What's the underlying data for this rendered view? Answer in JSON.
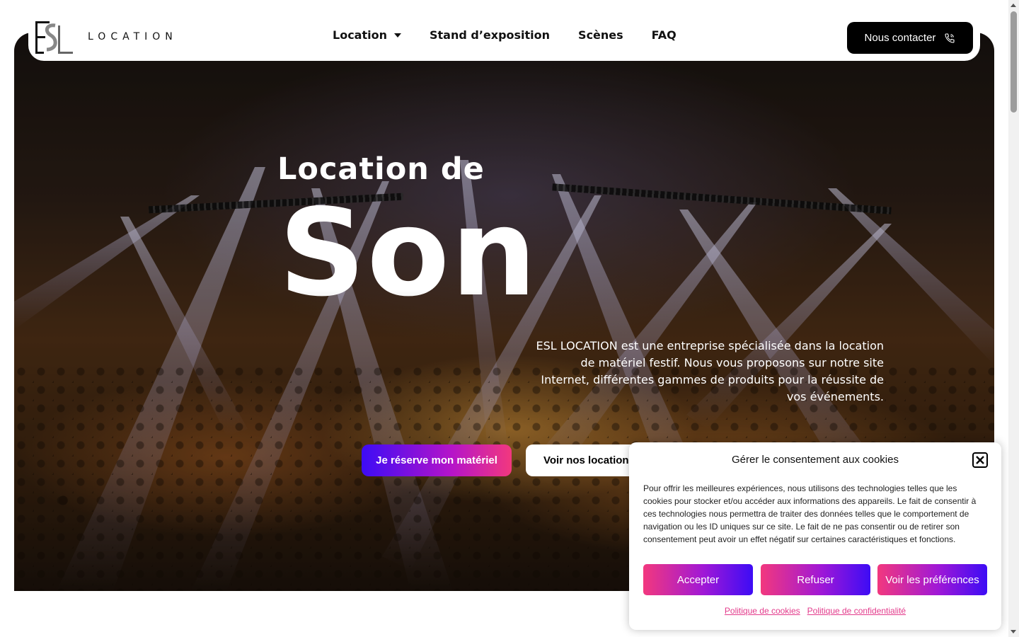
{
  "header": {
    "logo_text": "LOCATION",
    "logo_mark_letters": "ESL",
    "nav": [
      {
        "label": "Location",
        "has_dropdown": true
      },
      {
        "label": "Stand d’exposition"
      },
      {
        "label": "Scènes"
      },
      {
        "label": "FAQ"
      }
    ],
    "contact_label": "Nous contacter",
    "contact_icon": "phone-call-icon"
  },
  "hero": {
    "title_small": "Location de",
    "title_big": "Son",
    "description": "ESL LOCATION est une entreprise spécialisée dans la location de matériel festif. Nous vous proposons sur notre site Internet, différentes gammes de produits pour la réussite de vos événements.",
    "primary_button": "Je réserve mon matériel",
    "secondary_button": "Voir nos locations"
  },
  "cookie": {
    "title": "Gérer le consentement aux cookies",
    "text": "Pour offrir les meilleures expériences, nous utilisons des technologies telles que les cookies pour stocker et/ou accéder aux informations des appareils. Le fait de consentir à ces technologies nous permettra de traiter des données telles que le comportement de navigation ou les ID uniques sur ce site. Le fait de ne pas consentir ou de retirer son consentement peut avoir un effet négatif sur certaines caractéristiques et fonctions.",
    "accept": "Accepter",
    "refuse": "Refuser",
    "preferences": "Voir les préférences",
    "link_cookies": "Politique de cookies",
    "link_privacy": "Politique de confidentialité"
  },
  "colors": {
    "gradient_violet": "#3d0cf5",
    "gradient_pink": "#f2387e",
    "link_pink": "#e33a8b",
    "header_bg": "#ffffff",
    "contact_bg": "#000000"
  }
}
